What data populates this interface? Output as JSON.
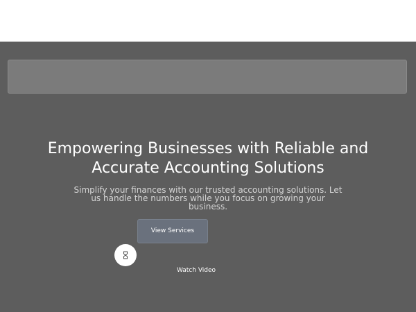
{
  "hero": {
    "headline": "Empowering Businesses with Reliable and Accurate Accounting Solutions",
    "subtext": "Simplify your finances with our trusted accounting solutions. Let us handle the numbers while you focus on growing your business.",
    "primary_button_label": "View Services",
    "video_label": "Watch Video",
    "play_icon": "play-icon"
  },
  "colors": {
    "hero_background": "#5d5d5d",
    "nav_strip": "#7b7b7b",
    "button_background": "#6a717d",
    "headline_text": "#ffffff"
  }
}
